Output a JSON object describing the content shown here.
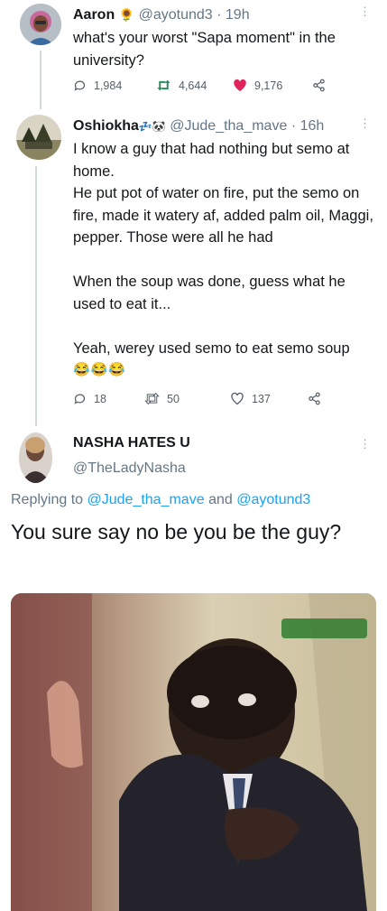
{
  "tweets": [
    {
      "name": "Aaron",
      "emoji": "🌻",
      "handle": "@ayotund3",
      "time": "19h",
      "text": [
        "what's your worst \"Sapa moment\" in the university?"
      ],
      "replies": "1,984",
      "retweets": "4,644",
      "likes": "9,176",
      "liked": true
    },
    {
      "name": "Oshiokha",
      "emoji": "💤🐼",
      "handle": "@Jude_tha_mave",
      "time": "16h",
      "text": [
        "I know a guy that had nothing but semo at home.",
        "He put pot of water on fire, put the semo on fire, made it watery af, added palm oil, Maggi, pepper. Those were all he had",
        "",
        "When the soup was done, guess what he used to eat it...",
        "",
        "Yeah, werey used semo to eat semo soup"
      ],
      "emojis": "😂😂😂",
      "replies": "18",
      "retweets": "50",
      "likes": "137",
      "liked": false
    },
    {
      "name": "NASHA HATES U",
      "handle": "@TheLadyNasha",
      "reply_prefix": "Replying to",
      "reply_user1": "@Jude_tha_mave",
      "reply_and": "and",
      "reply_user2": "@ayotund3",
      "text": "You sure say no be you be the guy?"
    }
  ],
  "icons": {
    "reply": "reply-icon",
    "retweet": "retweet-icon",
    "like": "heart-icon",
    "share": "share-icon",
    "more": "more-vertical-icon"
  },
  "colors": {
    "like_active": "#e0245e",
    "link": "#1da1f2",
    "muted": "#657786"
  }
}
